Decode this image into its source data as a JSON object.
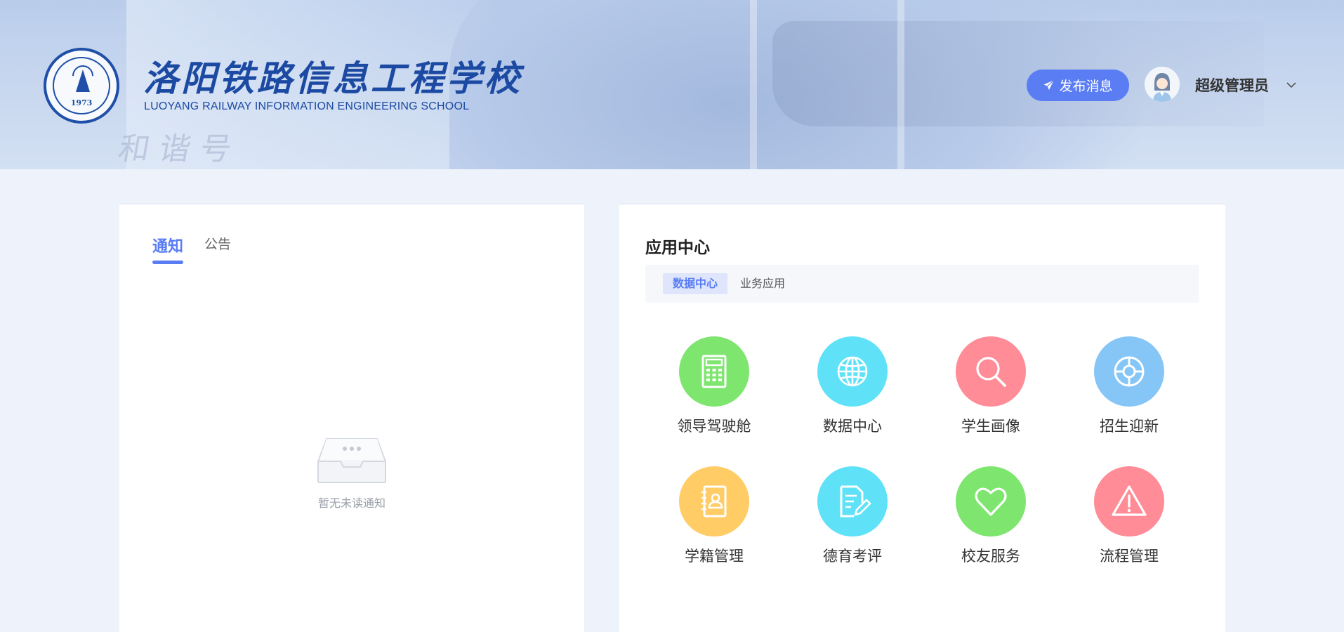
{
  "header": {
    "school_name_cn": "洛阳铁路信息工程学校",
    "school_name_en": "LUOYANG RAILWAY INFORMATION ENGINEERING SCHOOL",
    "seal_year": "1973",
    "train_text": "和谐号",
    "publish_button": "发布消息",
    "user_name": "超级管理员"
  },
  "notice": {
    "tabs": [
      {
        "label": "通知",
        "active": true
      },
      {
        "label": "公告",
        "active": false
      }
    ],
    "empty_text": "暂无未读通知"
  },
  "app_center": {
    "title": "应用中心",
    "subtabs": [
      {
        "label": "数据中心",
        "active": true
      },
      {
        "label": "业务应用",
        "active": false
      }
    ],
    "apps": [
      {
        "label": "领导驾驶舱",
        "icon": "calculator-icon",
        "color": "#7ee56f"
      },
      {
        "label": "数据中心",
        "icon": "globe-icon",
        "color": "#5fe2f8"
      },
      {
        "label": "学生画像",
        "icon": "magnifier-icon",
        "color": "#ff8c96"
      },
      {
        "label": "招生迎新",
        "icon": "lifebuoy-icon",
        "color": "#86c6f7"
      },
      {
        "label": "学籍管理",
        "icon": "contact-book-icon",
        "color": "#ffcc66"
      },
      {
        "label": "德育考评",
        "icon": "document-edit-icon",
        "color": "#5fe2f8"
      },
      {
        "label": "校友服务",
        "icon": "heart-icon",
        "color": "#7ee56f"
      },
      {
        "label": "流程管理",
        "icon": "warning-icon",
        "color": "#ff8c96"
      }
    ]
  },
  "colors": {
    "accent": "#5b7df4",
    "page_bg": "#eef2fa"
  }
}
